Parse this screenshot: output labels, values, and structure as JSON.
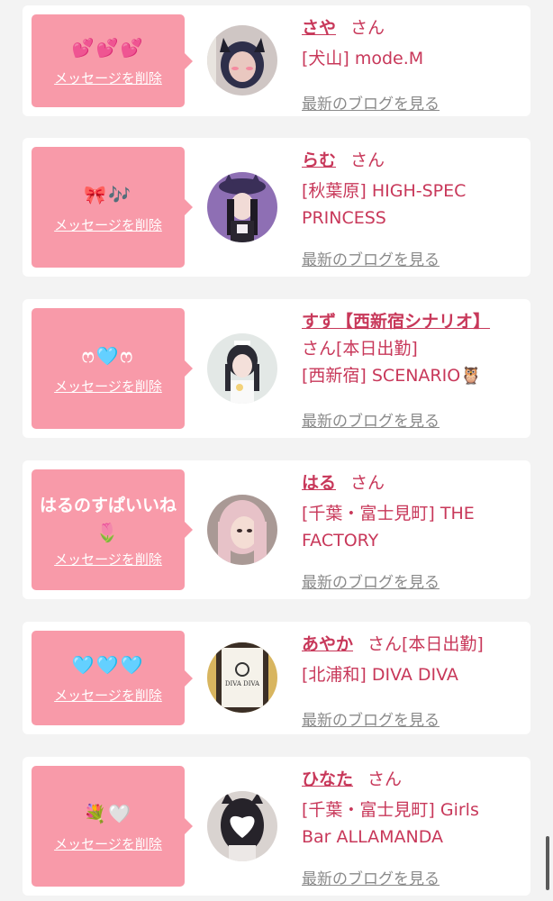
{
  "ui": {
    "delete_label": "メッセージを削除",
    "blog_label": "最新のブログを見る",
    "san": "さん"
  },
  "cards": [
    {
      "name": "さや",
      "san_suffix": "さん",
      "message": "💕💕💕",
      "shop_lines": [
        "[犬山] mode.M"
      ]
    },
    {
      "name": "らむ",
      "san_suffix": "さん",
      "message": "🎀🎶",
      "shop_lines": [
        "[秋葉原] HIGH-SPEC",
        "PRINCESS"
      ]
    },
    {
      "name": "すず【西新宿シナリオ】",
      "san_suffix": "さん[本日出勤]",
      "message": "ෆ🩵ෆ",
      "shop_lines": [
        "[西新宿] SCENARIO🦉"
      ]
    },
    {
      "name": "はる",
      "san_suffix": "さん",
      "message_lines": [
        "はるのすぱいいね",
        "🌷"
      ],
      "shop_lines": [
        "[千葉・富士見町] THE",
        "FACTORY"
      ]
    },
    {
      "name": "あやか",
      "san_suffix": "さん[本日出勤]",
      "message": "🩵🩵🩵",
      "shop_lines": [
        "[北浦和] DIVA DIVA"
      ],
      "avatar_logo_text": "DIVA DIVA"
    },
    {
      "name": "ひなた",
      "san_suffix": "さん",
      "message": "💐🤍",
      "shop_lines": [
        "[千葉・富士見町] Girls",
        "Bar ALLAMANDA"
      ]
    }
  ],
  "colors": {
    "bubble": "#f89aa9",
    "accent": "#c8385a",
    "muted": "#8a8a8a",
    "background": "#f3f3f3"
  }
}
